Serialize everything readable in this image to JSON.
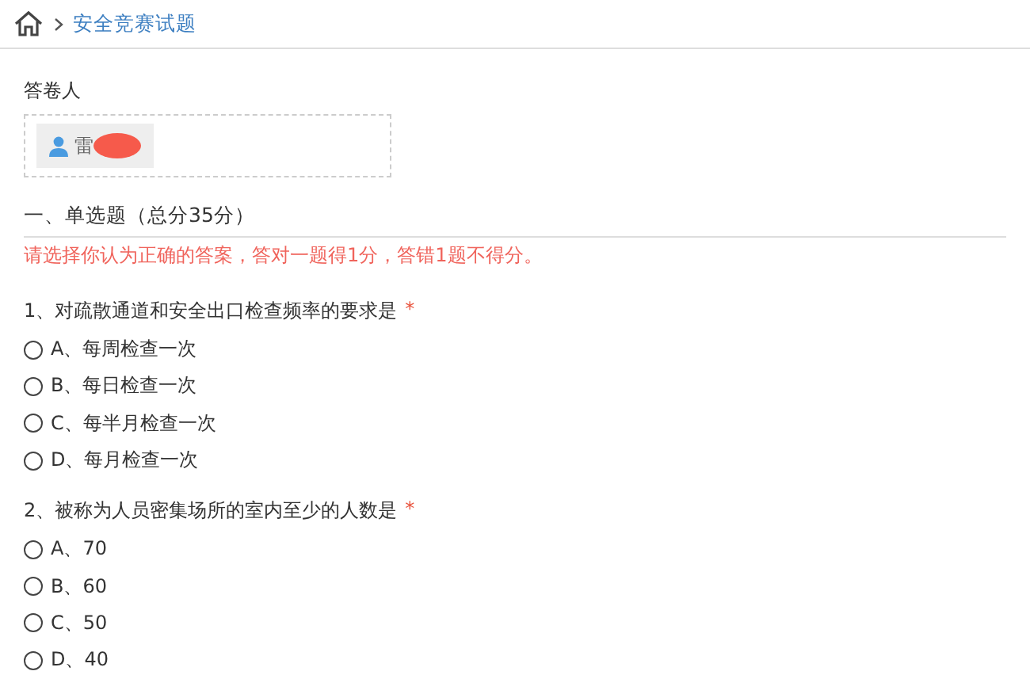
{
  "breadcrumb": {
    "current": "安全竞赛试题"
  },
  "respondent": {
    "label": "答卷人",
    "name": "雷",
    "redacted": true
  },
  "section": {
    "title": "一、单选题（总分35分）",
    "instruction": "请选择你认为正确的答案，答对一题得1分，答错1题不得分。"
  },
  "questions": [
    {
      "text": "1、对疏散通道和安全出口检查频率的要求是",
      "required_mark": "*",
      "options": [
        {
          "label": "A、每周检查一次",
          "selected": false
        },
        {
          "label": "B、每日检查一次",
          "selected": false
        },
        {
          "label": "C、每半月检查一次",
          "selected": false
        },
        {
          "label": "D、每月检查一次",
          "selected": false
        }
      ]
    },
    {
      "text": "2、被称为人员密集场所的室内至少的人数是",
      "required_mark": "*",
      "options": [
        {
          "label": "A、70",
          "selected": false
        },
        {
          "label": "B、60",
          "selected": false
        },
        {
          "label": "C、50",
          "selected": false
        },
        {
          "label": "D、40",
          "selected": false
        }
      ]
    }
  ]
}
